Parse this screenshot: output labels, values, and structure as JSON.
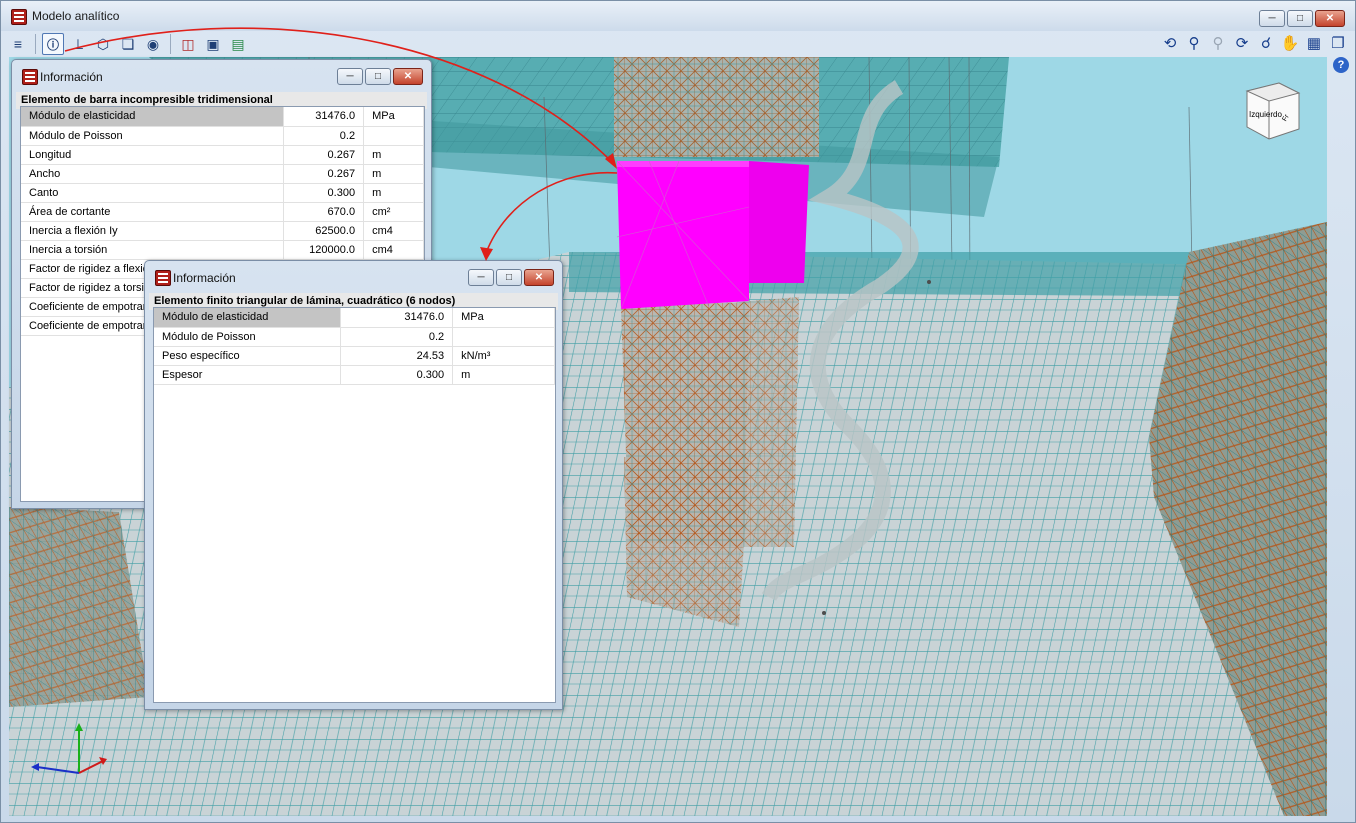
{
  "window": {
    "title": "Modelo analítico"
  },
  "toolbar_icons": [
    "layers-icon",
    "info-icon",
    "axes-icon",
    "cube-view-icon",
    "section-view-icon",
    "visibility-icon",
    "split-view-icon",
    "fit-view-icon",
    "panel-view-icon"
  ],
  "right_toolbar_icons": [
    "zoom-previous-icon",
    "zoom-all-icon",
    "zoom-window-icon",
    "rotate-icon",
    "zoom-icon",
    "pan-icon",
    "capture-icon",
    "book-icon"
  ],
  "view_cube": {
    "face_left": "Izquierdo",
    "face_front": "Fr"
  },
  "info_window_1": {
    "title": "Información",
    "subtitle": "Elemento de barra incompresible tridimensional",
    "rows": [
      {
        "label": "Módulo de elasticidad",
        "value": "31476.0",
        "unit": "MPa"
      },
      {
        "label": "Módulo de Poisson",
        "value": "0.2",
        "unit": ""
      },
      {
        "label": "Longitud",
        "value": "0.267",
        "unit": "m"
      },
      {
        "label": "Ancho",
        "value": "0.267",
        "unit": "m"
      },
      {
        "label": "Canto",
        "value": "0.300",
        "unit": "m"
      },
      {
        "label": "Área de cortante",
        "value": "670.0",
        "unit": "cm²"
      },
      {
        "label": "Inercia a flexión Iy",
        "value": "62500.0",
        "unit": "cm4"
      },
      {
        "label": "Inercia a torsión",
        "value": "120000.0",
        "unit": "cm4"
      },
      {
        "label": "Factor de rigidez a flexión",
        "value": "",
        "unit": ""
      },
      {
        "label": "Factor de rigidez a torsión",
        "value": "",
        "unit": ""
      },
      {
        "label": "Coeficiente de empotramiento",
        "value": "",
        "unit": ""
      },
      {
        "label": "Coeficiente de empotramiento",
        "value": "",
        "unit": ""
      }
    ]
  },
  "info_window_2": {
    "title": "Información",
    "subtitle": "Elemento finito triangular de lámina, cuadrático (6 nodos)",
    "rows": [
      {
        "label": "Módulo de elasticidad",
        "value": "31476.0",
        "unit": "MPa"
      },
      {
        "label": "Módulo de Poisson",
        "value": "0.2",
        "unit": ""
      },
      {
        "label": "Peso específico",
        "value": "24.53",
        "unit": "kN/m³"
      },
      {
        "label": "Espesor",
        "value": "0.300",
        "unit": "m"
      }
    ]
  },
  "colors": {
    "highlight": "#ff00ff",
    "mesh_fill": "#3aa3a5",
    "mesh_line": "#b4581c",
    "sky": "#9ed8e6",
    "arrow": "#e0201a"
  }
}
